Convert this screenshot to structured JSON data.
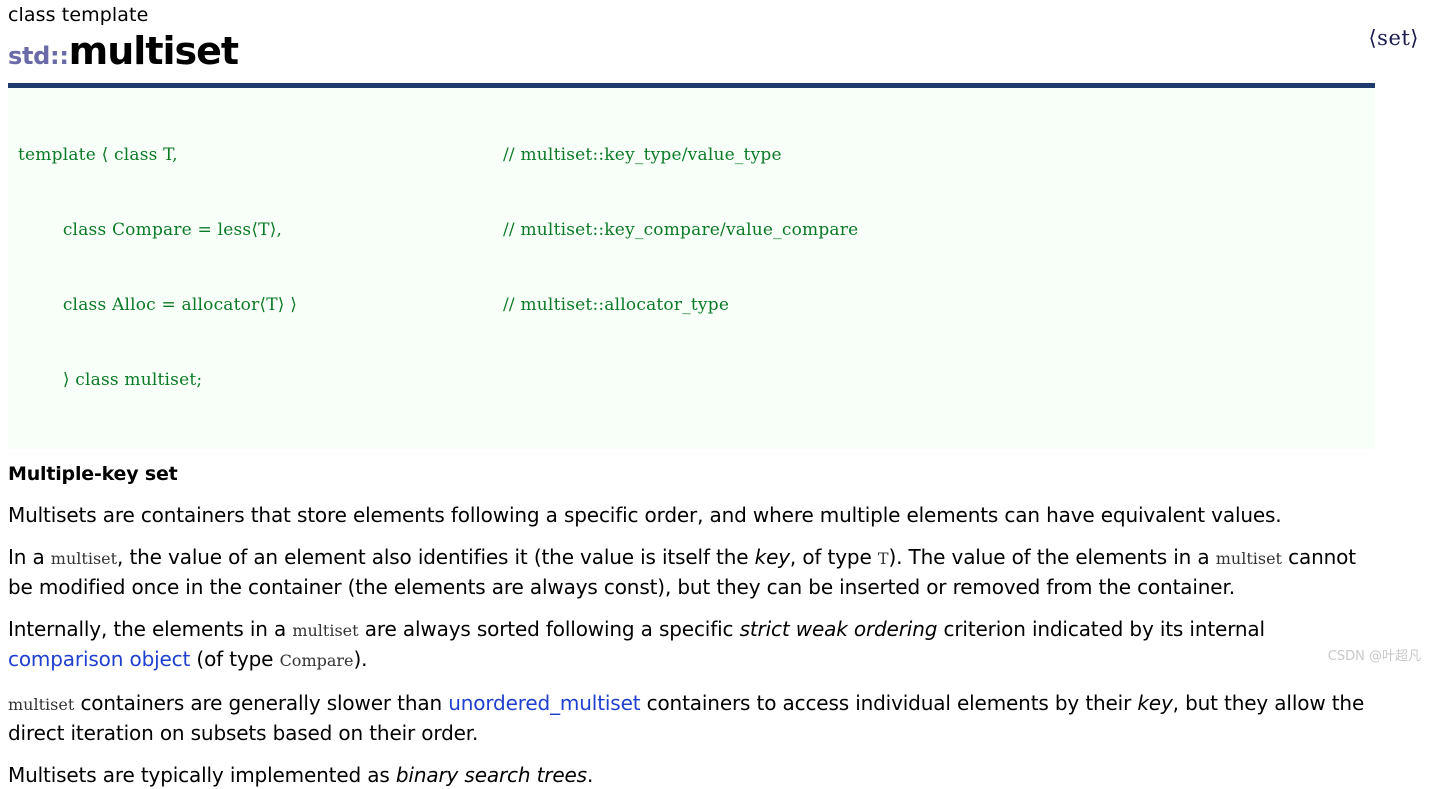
{
  "header": {
    "kind": "class template",
    "namespace": "std::",
    "name": "multiset",
    "include_header": "⟨set⟩"
  },
  "signature": {
    "lines": [
      {
        "code": "template ⟨ class T,",
        "comment": "// multiset::key_type/value_type"
      },
      {
        "code": "        class Compare = less⟨T⟩,",
        "comment": "// multiset::key_compare/value_compare"
      },
      {
        "code": "        class Alloc = allocator⟨T⟩ ⟩",
        "comment": "// multiset::allocator_type"
      },
      {
        "code": "        ⟩ class multiset;",
        "comment": ""
      }
    ]
  },
  "section": {
    "title": "Multiple-key set"
  },
  "paragraphs": {
    "p1": {
      "t1": "Multisets are containers that store elements following a specific order, and where multiple elements can have equivalent values."
    },
    "p2": {
      "t1": "In a ",
      "c1": "multiset",
      "t2": ", the value of an element also identifies it (the value is itself the ",
      "i1": "key",
      "t3": ", of type ",
      "c2": "T",
      "t4": "). The value of the elements in a ",
      "c3": "multiset",
      "t5": " cannot be modified once in the container (the elements are always const), but they can be inserted or removed from the container."
    },
    "p3": {
      "t1": "Internally, the elements in a ",
      "c1": "multiset",
      "t2": " are always sorted following a specific ",
      "i1": "strict weak ordering",
      "t3": " criterion indicated by its internal ",
      "a1": "comparison object",
      "t4": " (of type ",
      "c2": "Compare",
      "t5": ")."
    },
    "p4": {
      "c1": "multiset",
      "t1": " containers are generally slower than ",
      "a1": "unordered_multiset",
      "t2": " containers to access individual elements by their ",
      "i1": "key",
      "t3": ", but they allow the direct iteration on subsets based on their order."
    },
    "p5": {
      "t1": "Multisets are typically implemented as ",
      "i1": "binary search trees",
      "t2": "."
    }
  },
  "watermark": {
    "text": "CSDN @叶超凡"
  },
  "colors": {
    "code_green": "#0b7a27",
    "code_bg": "#f8fff8",
    "rule_navy": "#1f3a6e",
    "namespace_purple": "#6a6aa8",
    "link_blue": "#1f3fcf",
    "watermark_gray": "#c9c9c9"
  }
}
